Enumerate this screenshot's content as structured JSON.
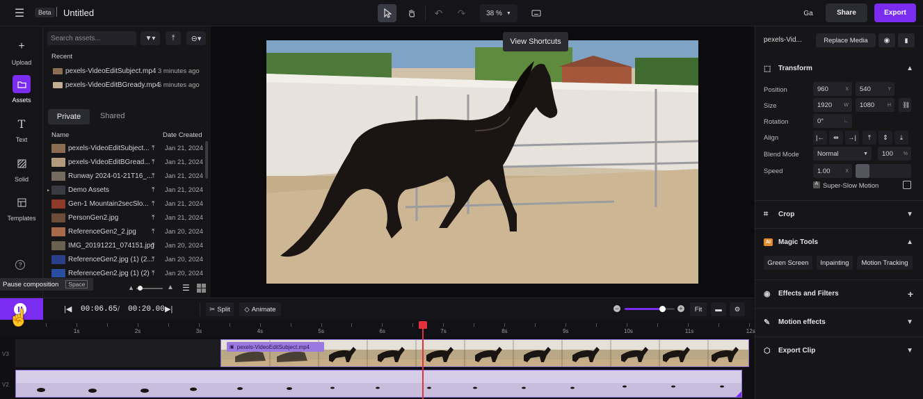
{
  "header": {
    "beta": "Beta",
    "title": "Untitled",
    "zoom": "38 %",
    "tooltip": "View Shortcuts",
    "share": "Share",
    "export": "Export",
    "avatar": "Ga"
  },
  "rail": {
    "upload": "Upload",
    "assets": "Assets",
    "text": "Text",
    "solid": "Solid",
    "templates": "Templates"
  },
  "assets": {
    "search_placeholder": "Search assets...",
    "recent_label": "Recent",
    "recent": [
      {
        "name": "pexels-VideoEditSubject.mp4",
        "time": "3 minutes ago"
      },
      {
        "name": "pexels-VideoEditBGready.mp4",
        "time": "6 minutes ago"
      }
    ],
    "tabs": {
      "private": "Private",
      "shared": "Shared"
    },
    "col_name": "Name",
    "col_date": "Date Created",
    "files": [
      {
        "name": "pexels-VideoEditSubject...",
        "date": "Jan 21, 2024",
        "color": "#8a6d52"
      },
      {
        "name": "pexels-VideoEditBGread...",
        "date": "Jan 21, 2024",
        "color": "#b39b7d"
      },
      {
        "name": "Runway 2024-01-21T16_...",
        "date": "Jan 21, 2024",
        "color": "#756a5e"
      },
      {
        "name": "Demo Assets",
        "date": "Jan 21, 2024",
        "color": "#3a3a42"
      },
      {
        "name": "Gen-1 Mountain2secSlo...",
        "date": "Jan 21, 2024",
        "color": "#8e3a2a"
      },
      {
        "name": "PersonGen2.jpg",
        "date": "Jan 21, 2024",
        "color": "#6b4d3a"
      },
      {
        "name": "ReferenceGen2_2.jpg",
        "date": "Jan 20, 2024",
        "color": "#a86a4a"
      },
      {
        "name": "IMG_20191221_074151.jpg",
        "date": "Jan 20, 2024",
        "color": "#6a6050"
      },
      {
        "name": "ReferenceGen2.jpg (1) (2...",
        "date": "Jan 20, 2024",
        "color": "#2a3e8a"
      },
      {
        "name": "ReferenceGen2.jpg (1) (2)",
        "date": "Jan 20, 2024",
        "color": "#2a4ea0"
      }
    ]
  },
  "pause_tooltip": {
    "label": "Pause composition",
    "key": "Space"
  },
  "transport": {
    "current": "00:06.65",
    "sep": "/",
    "total": "00:20.00",
    "split": "Split",
    "animate": "Animate",
    "fit": "Fit"
  },
  "ruler": [
    "1s",
    "2s",
    "3s",
    "4s",
    "5s",
    "6s",
    "7s",
    "8s",
    "9s",
    "10s",
    "11s",
    "12s"
  ],
  "tracks": {
    "v3": "V3",
    "v2": "V2",
    "clip_name": "pexels-VideoEditSubject.mp4"
  },
  "inspector": {
    "media_name": "pexels-Vid...",
    "replace": "Replace Media",
    "transform": "Transform",
    "position_label": "Position",
    "pos_x": "960",
    "pos_y": "540",
    "size_label": "Size",
    "size_w": "1920",
    "size_h": "1080",
    "rotation_label": "Rotation",
    "rotation": "0°",
    "align_label": "Align",
    "blend_label": "Blend Mode",
    "blend": "Normal",
    "opacity": "100",
    "speed_label": "Speed",
    "speed": "1.00",
    "slowmo": "Super-Slow Motion",
    "crop": "Crop",
    "magic": "Magic Tools",
    "green": "Green Screen",
    "inpaint": "Inpainting",
    "motion": "Motion Tracking",
    "effects": "Effects and Filters",
    "motion_fx": "Motion effects",
    "export_clip": "Export Clip"
  },
  "colors": {
    "accent": "#7a2cf0",
    "playhead": "#e0323c"
  }
}
